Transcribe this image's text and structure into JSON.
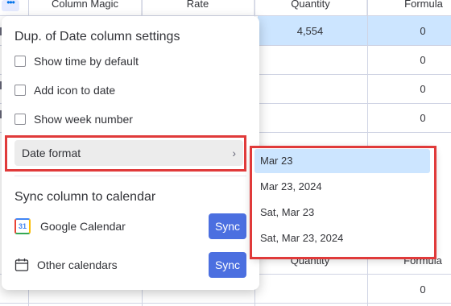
{
  "table": {
    "headers": [
      "Column Magic",
      "Rate",
      "Quantity",
      "Formula"
    ],
    "selected_row": {
      "quantity": "4,554",
      "formula": "0"
    },
    "formula_values": [
      "0",
      "0",
      "0"
    ],
    "repeat_headers": {
      "quantity": "Quantity",
      "formula": "Formula"
    },
    "last_formula": "0"
  },
  "menu": {
    "title": "Dup. of Date column settings",
    "options": [
      {
        "label": "Show time by default",
        "checked": false
      },
      {
        "label": "Add icon to date",
        "checked": false
      },
      {
        "label": "Show week number",
        "checked": false
      }
    ],
    "date_format_label": "Date format",
    "sync_section_title": "Sync column to calendar",
    "calendars": [
      {
        "label": "Google Calendar",
        "icon": "google-calendar-icon",
        "icon_text": "31",
        "button": "Sync"
      },
      {
        "label": "Other calendars",
        "icon": "calendar-icon",
        "button": "Sync"
      }
    ]
  },
  "date_formats": {
    "selected": "Mar 23",
    "options": [
      "Mar 23",
      "Mar 23, 2024",
      "Sat, Mar 23",
      "Sat, Mar 23, 2024"
    ]
  },
  "colors": {
    "accent": "#4b6fe0",
    "selected_bg": "#cce5ff",
    "highlight": "#e03a3a"
  }
}
